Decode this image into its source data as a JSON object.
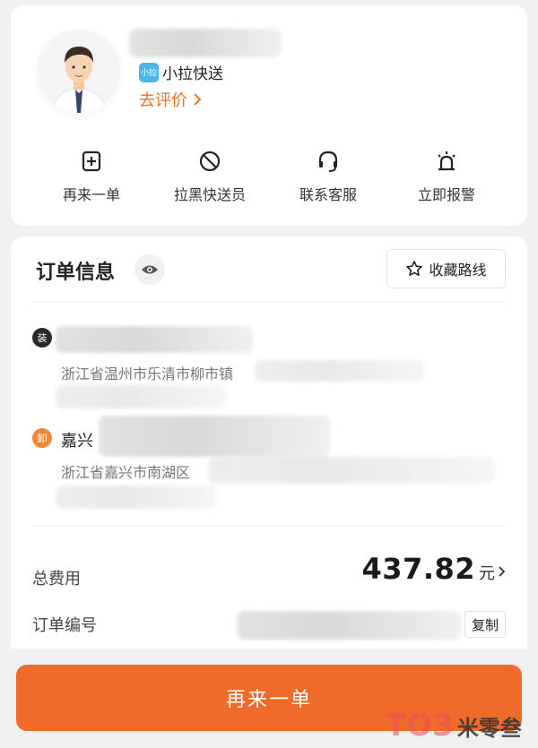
{
  "driver": {
    "brand_logo_text": "小拉",
    "brand_name": "小拉快送",
    "rate_link": "去评价",
    "actions": [
      {
        "label": "再来一单",
        "icon": "plus-square-icon"
      },
      {
        "label": "拉黑快送员",
        "icon": "block-icon"
      },
      {
        "label": "联系客服",
        "icon": "headset-icon"
      },
      {
        "label": "立即报警",
        "icon": "alarm-icon"
      }
    ]
  },
  "order": {
    "title": "订单信息",
    "favorite_label": "收藏路线",
    "load": {
      "badge": "装",
      "address": "浙江省温州市乐清市柳市镇"
    },
    "unload": {
      "badge": "卸",
      "name": "嘉兴",
      "address": "浙江省嘉兴市南湖区"
    },
    "fee_label": "总费用",
    "fee_value": "437.82",
    "fee_unit": "元",
    "order_no_label": "订单编号",
    "copy_label": "复制"
  },
  "cta_label": "再来一单",
  "watermark": {
    "logo": "TO3",
    "text": "米零叁"
  },
  "colors": {
    "accent": "#f06a2a",
    "brand_blue": "#49b7ea",
    "unload_badge": "#f0883a"
  }
}
